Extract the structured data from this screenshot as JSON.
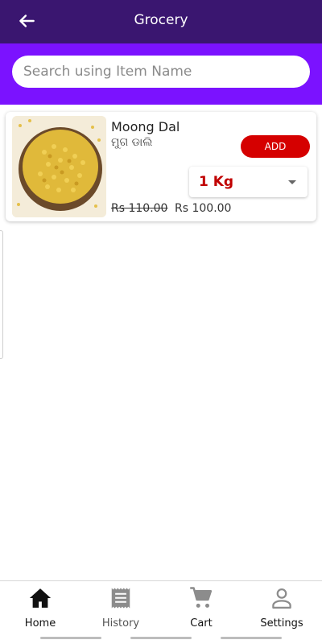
{
  "appbar": {
    "title": "Grocery"
  },
  "search": {
    "placeholder": "Search using Item Name"
  },
  "products": [
    {
      "name": "Moong Dal",
      "local_name": "ମୁଗ ଡାଲି",
      "add_label": "ADD",
      "quantity": "1 Kg",
      "old_price": "Rs 110.00",
      "new_price": "Rs 100.00"
    }
  ],
  "nav": {
    "items": [
      {
        "label": "Home",
        "icon": "home-icon",
        "active": true
      },
      {
        "label": "History",
        "icon": "receipt-icon",
        "active": false
      },
      {
        "label": "Cart",
        "icon": "cart-icon",
        "active": false
      },
      {
        "label": "Settings",
        "icon": "user-icon",
        "active": false
      }
    ]
  },
  "colors": {
    "appbar": "#3a1670",
    "search_band": "#7b12ff",
    "add_button": "#d50000",
    "quantity_text": "#c00000"
  }
}
